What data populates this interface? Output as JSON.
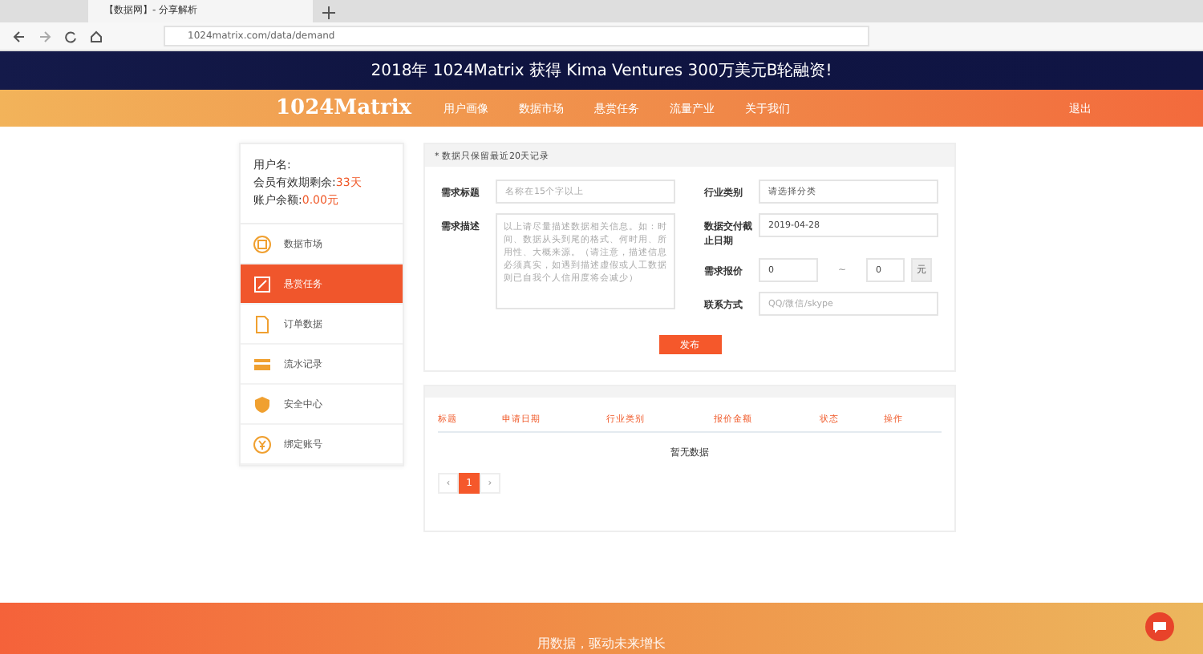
{
  "browser": {
    "tab_title": "【数据网】- 分享解析",
    "url": "1024matrix.com/data/demand"
  },
  "banner": {
    "text": "2018年 1024Matrix 获得 Kima Ventures 300万美元B轮融资!"
  },
  "nav": {
    "logo": "1024Matrix",
    "items": [
      {
        "label": "用户画像",
        "selected": false
      },
      {
        "label": "数据市场",
        "selected": false
      },
      {
        "label": "悬赏任务",
        "selected": false
      },
      {
        "label": "流量产业",
        "selected": false
      },
      {
        "label": "关于我们",
        "selected": false
      }
    ],
    "logout": "退出"
  },
  "user": {
    "name_label": "用户名:",
    "days_label": "会员有效期剩余:",
    "days": "33天",
    "balance_label": "账户余额:",
    "balance": "0.00元"
  },
  "sidebar": {
    "items": [
      {
        "label": "数据市场",
        "selected": false
      },
      {
        "label": "悬赏任务",
        "selected": true
      },
      {
        "label": "订单数据",
        "selected": false
      },
      {
        "label": "流水记录",
        "selected": false
      },
      {
        "label": "安全中心",
        "selected": false
      },
      {
        "label": "绑定账号",
        "selected": false
      }
    ]
  },
  "form": {
    "notice": "* 数据只保留最近20天记录",
    "title_label": "需求标题",
    "title_placeholder": "名称在15个字以上",
    "desc_label": "需求描述",
    "desc_placeholder": "以上请尽量描述数据相关信息。如：时间、数据从头到尾的格式、何时用、所用性、大概来源。（请注意，描述信息必须真实，如遇到描述虚假或人工数据则已自我个人信用度将会减少）",
    "category_label": "行业类别",
    "category_placeholder": "请选择分类",
    "deadline_label": "数据交付截止日期",
    "deadline": "2019-04-28",
    "price_label": "需求报价",
    "price_min": "0",
    "price_sep": "~",
    "price_max": "0",
    "price_unit": "元",
    "contact_label": "联系方式",
    "contact_placeholder": "QQ/微信/skype",
    "submit": "发布"
  },
  "table": {
    "columns": [
      "标题",
      "申请日期",
      "行业类别",
      "报价金额",
      "状态",
      "操作"
    ],
    "empty": "暂无数据",
    "pagination": {
      "prev": "‹",
      "pages": [
        {
          "label": "1",
          "selected": true
        }
      ],
      "next": "›"
    }
  },
  "footer": {
    "slogan": "用数据，驱动未来增长"
  }
}
